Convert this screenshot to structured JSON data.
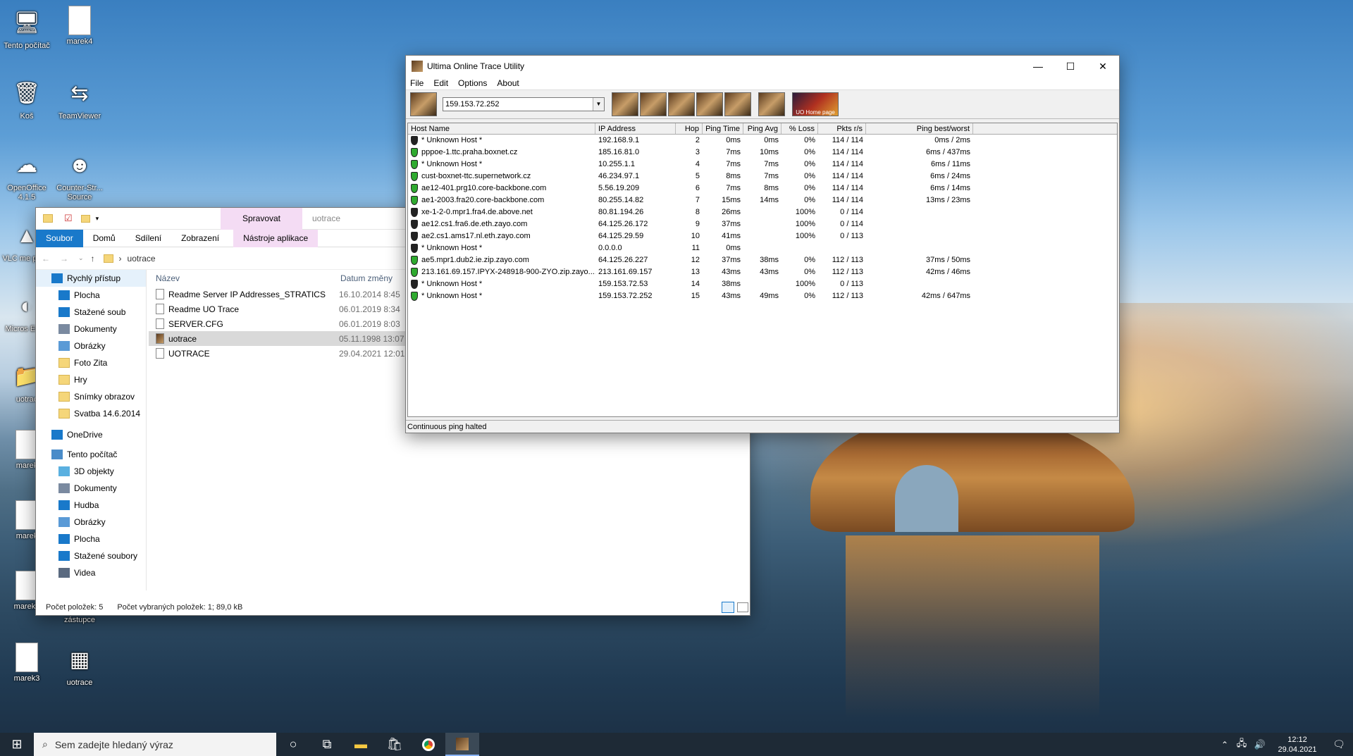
{
  "desktop": {
    "icons": [
      {
        "label": "Tento počítač",
        "icon": "computer-icon"
      },
      {
        "label": "marek4",
        "icon": "document-icon"
      },
      {
        "label": "Koš",
        "icon": "recycle-bin-icon"
      },
      {
        "label": "TeamViewer",
        "icon": "teamviewer-icon"
      },
      {
        "label": "OpenOffice 4.1.5",
        "icon": "openoffice-icon"
      },
      {
        "label": "Counter-Str... Source",
        "icon": "counter-strike-icon"
      },
      {
        "label": "VLC me playe",
        "icon": "vlc-icon"
      },
      {
        "label": "Micros Edge",
        "icon": "edge-icon"
      },
      {
        "label": "uotrac",
        "icon": "folder-icon"
      },
      {
        "label": "marek",
        "icon": "document-icon"
      },
      {
        "label": "marek",
        "icon": "document-icon"
      },
      {
        "label": "marek2",
        "icon": "document-icon"
      },
      {
        "label": "marek3",
        "icon": "document-icon"
      },
      {
        "label": "uotrace",
        "icon": "winrar-icon"
      },
      {
        "label": "Plátce - zástupce",
        "icon": "shortcut-icon"
      }
    ]
  },
  "explorer": {
    "context_tab": "Spravovat",
    "title": "uotrace",
    "ribbon_tabs": [
      "Soubor",
      "Domů",
      "Sdílení",
      "Zobrazení",
      "Nástroje aplikace"
    ],
    "address": "uotrace",
    "nav_items": [
      {
        "label": "Rychlý přístup",
        "icon": "star-icon"
      },
      {
        "label": "Plocha",
        "icon": "desktop-icon"
      },
      {
        "label": "Stažené soub",
        "icon": "download-icon"
      },
      {
        "label": "Dokumenty",
        "icon": "documents-icon"
      },
      {
        "label": "Obrázky",
        "icon": "pictures-icon"
      },
      {
        "label": "Foto Zita",
        "icon": "folder-icon"
      },
      {
        "label": "Hry",
        "icon": "folder-icon"
      },
      {
        "label": "Snímky obrazov",
        "icon": "folder-icon"
      },
      {
        "label": "Svatba 14.6.2014",
        "icon": "folder-icon"
      },
      {
        "label": "OneDrive",
        "icon": "cloud-icon"
      },
      {
        "label": "Tento počítač",
        "icon": "computer-icon"
      },
      {
        "label": "3D objekty",
        "icon": "cube-icon"
      },
      {
        "label": "Dokumenty",
        "icon": "documents-icon"
      },
      {
        "label": "Hudba",
        "icon": "music-icon"
      },
      {
        "label": "Obrázky",
        "icon": "pictures-icon"
      },
      {
        "label": "Plocha",
        "icon": "desktop-icon"
      },
      {
        "label": "Stažené soubory",
        "icon": "download-icon"
      },
      {
        "label": "Videa",
        "icon": "video-icon"
      }
    ],
    "columns": {
      "name": "Název",
      "date": "Datum změny"
    },
    "files": [
      {
        "name": "Readme Server IP Addresses_STRATICS",
        "date": "16.10.2014 8:45"
      },
      {
        "name": "Readme UO Trace",
        "date": "06.01.2019 8:34"
      },
      {
        "name": "SERVER.CFG",
        "date": "06.01.2019 8:03"
      },
      {
        "name": "uotrace",
        "date": "05.11.1998 13:07"
      },
      {
        "name": "UOTRACE",
        "date": "29.04.2021 12:01"
      }
    ],
    "status_count": "Počet položek: 5",
    "status_selected": "Počet vybraných položek: 1; 89,0 kB"
  },
  "trace": {
    "title": "Ultima Online Trace Utility",
    "menu": [
      "File",
      "Edit",
      "Options",
      "About"
    ],
    "host_value": "159.153.72.252",
    "toolbar": [
      {
        "label": "",
        "icon": "trace-icon"
      },
      {
        "label": "",
        "icon": "stop-icon"
      },
      {
        "label": "",
        "icon": "ping-icon"
      },
      {
        "label": "",
        "icon": "save-icon"
      },
      {
        "label": "",
        "icon": "options-icon"
      },
      {
        "label": "",
        "icon": "help-icon"
      },
      {
        "label": "",
        "icon": "about-icon"
      },
      {
        "label": "UO Home page",
        "icon": "homepage-icon"
      }
    ],
    "headers": [
      "Host Name",
      "IP Address",
      "Hop",
      "Ping Time",
      "Ping Avg",
      "% Loss",
      "Pkts r/s",
      "Ping best/worst"
    ],
    "rows": [
      {
        "host": "* Unknown Host *",
        "ip": "192.168.9.1",
        "hop": "2",
        "time": "0ms",
        "avg": "0ms",
        "loss": "0%",
        "pkts": "114 / 114",
        "bw": "0ms / 2ms",
        "ok": false
      },
      {
        "host": "pppoe-1.ttc.praha.boxnet.cz",
        "ip": "185.16.81.0",
        "hop": "3",
        "time": "7ms",
        "avg": "10ms",
        "loss": "0%",
        "pkts": "114 / 114",
        "bw": "6ms / 437ms",
        "ok": true
      },
      {
        "host": "* Unknown Host *",
        "ip": "10.255.1.1",
        "hop": "4",
        "time": "7ms",
        "avg": "7ms",
        "loss": "0%",
        "pkts": "114 / 114",
        "bw": "6ms / 11ms",
        "ok": true
      },
      {
        "host": "cust-boxnet-ttc.supernetwork.cz",
        "ip": "46.234.97.1",
        "hop": "5",
        "time": "8ms",
        "avg": "7ms",
        "loss": "0%",
        "pkts": "114 / 114",
        "bw": "6ms / 24ms",
        "ok": true
      },
      {
        "host": "ae12-401.prg10.core-backbone.com",
        "ip": "5.56.19.209",
        "hop": "6",
        "time": "7ms",
        "avg": "8ms",
        "loss": "0%",
        "pkts": "114 / 114",
        "bw": "6ms / 14ms",
        "ok": true
      },
      {
        "host": "ae1-2003.fra20.core-backbone.com",
        "ip": "80.255.14.82",
        "hop": "7",
        "time": "15ms",
        "avg": "14ms",
        "loss": "0%",
        "pkts": "114 / 114",
        "bw": "13ms / 23ms",
        "ok": true
      },
      {
        "host": "xe-1-2-0.mpr1.fra4.de.above.net",
        "ip": "80.81.194.26",
        "hop": "8",
        "time": "26ms",
        "avg": "",
        "loss": "100%",
        "pkts": "0 / 114",
        "bw": "",
        "ok": false
      },
      {
        "host": "ae12.cs1.fra6.de.eth.zayo.com",
        "ip": "64.125.26.172",
        "hop": "9",
        "time": "37ms",
        "avg": "",
        "loss": "100%",
        "pkts": "0 / 114",
        "bw": "",
        "ok": false
      },
      {
        "host": "ae2.cs1.ams17.nl.eth.zayo.com",
        "ip": "64.125.29.59",
        "hop": "10",
        "time": "41ms",
        "avg": "",
        "loss": "100%",
        "pkts": "0 / 113",
        "bw": "",
        "ok": false
      },
      {
        "host": "* Unknown Host *",
        "ip": "0.0.0.0",
        "hop": "11",
        "time": "0ms",
        "avg": "",
        "loss": "",
        "pkts": "",
        "bw": "",
        "ok": false
      },
      {
        "host": "ae5.mpr1.dub2.ie.zip.zayo.com",
        "ip": "64.125.26.227",
        "hop": "12",
        "time": "37ms",
        "avg": "38ms",
        "loss": "0%",
        "pkts": "112 / 113",
        "bw": "37ms / 50ms",
        "ok": true
      },
      {
        "host": "213.161.69.157.IPYX-248918-900-ZYO.zip.zayo....",
        "ip": "213.161.69.157",
        "hop": "13",
        "time": "43ms",
        "avg": "43ms",
        "loss": "0%",
        "pkts": "112 / 113",
        "bw": "42ms / 46ms",
        "ok": true
      },
      {
        "host": "* Unknown Host *",
        "ip": "159.153.72.53",
        "hop": "14",
        "time": "38ms",
        "avg": "",
        "loss": "100%",
        "pkts": "0 / 113",
        "bw": "",
        "ok": false
      },
      {
        "host": "* Unknown Host *",
        "ip": "159.153.72.252",
        "hop": "15",
        "time": "43ms",
        "avg": "49ms",
        "loss": "0%",
        "pkts": "112 / 113",
        "bw": "42ms / 647ms",
        "ok": true
      }
    ],
    "status": "Continuous ping halted"
  },
  "taskbar": {
    "search_placeholder": "Sem zadejte hledaný výraz",
    "time": "12:12",
    "date": "29.04.2021"
  },
  "colors": {
    "ok_shield": "#2faa2f",
    "bad_shield": "#222222",
    "accent": "#1979ca"
  }
}
